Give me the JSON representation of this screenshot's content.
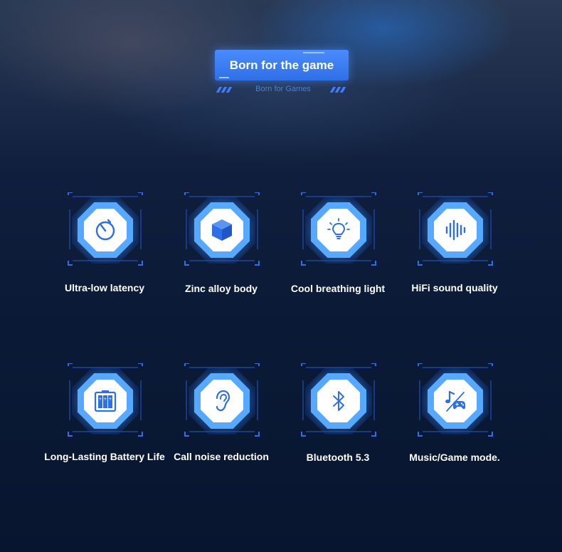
{
  "header": {
    "title": "Born for the game",
    "subtitle": "Born for Games"
  },
  "colors": {
    "accent": "#3d7dff",
    "icon_blue": "#2f6fe6",
    "text": "#ffffff",
    "background": "#0a1a36"
  },
  "features": [
    {
      "label": "Ultra-low latency",
      "icon": "stopwatch-icon"
    },
    {
      "label": "Zinc alloy body",
      "icon": "cube-icon"
    },
    {
      "label": "Cool breathing light",
      "icon": "lightbulb-icon"
    },
    {
      "label": "HiFi sound quality",
      "icon": "sound-wave-icon"
    },
    {
      "label": "Long-Lasting Battery Life",
      "icon": "battery-icon"
    },
    {
      "label": "Call noise reduction",
      "icon": "ear-icon"
    },
    {
      "label": "Bluetooth 5.3",
      "icon": "bluetooth-icon"
    },
    {
      "label": "Music/Game mode.",
      "icon": "music-game-icon"
    }
  ]
}
